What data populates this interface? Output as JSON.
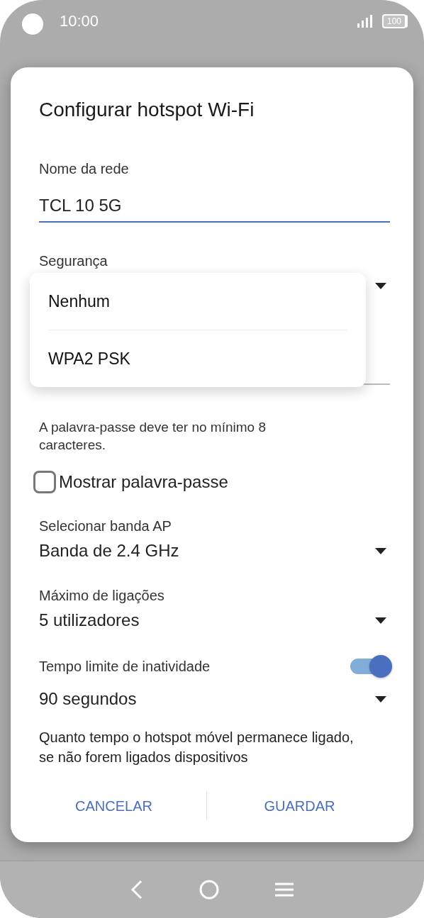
{
  "status_bar": {
    "time": "10:00",
    "battery": "100"
  },
  "dialog": {
    "title": "Configurar hotspot Wi-Fi",
    "network_name": {
      "label": "Nome da rede",
      "value": "TCL 10 5G"
    },
    "security": {
      "label": "Segurança",
      "options": [
        {
          "label": "Nenhum"
        },
        {
          "label": "WPA2 PSK"
        }
      ]
    },
    "password_hint": "A palavra-passe deve ter no mínimo 8 caracteres.",
    "show_password": {
      "label": "Mostrar palavra-passe",
      "checked": false
    },
    "fields": [
      {
        "label": "Selecionar banda AP",
        "value": "Banda de 2.4 GHz"
      },
      {
        "label": "Máximo de ligações",
        "value": "5 utilizadores"
      }
    ],
    "timeout": {
      "label": "Tempo limite de inatividade",
      "on": true,
      "value": "90 segundos",
      "description": "Quanto tempo o hotspot móvel permanece ligado, se não forem ligados dispositivos"
    },
    "buttons": [
      {
        "label": "CANCELAR"
      },
      {
        "label": "GUARDAR"
      }
    ]
  }
}
